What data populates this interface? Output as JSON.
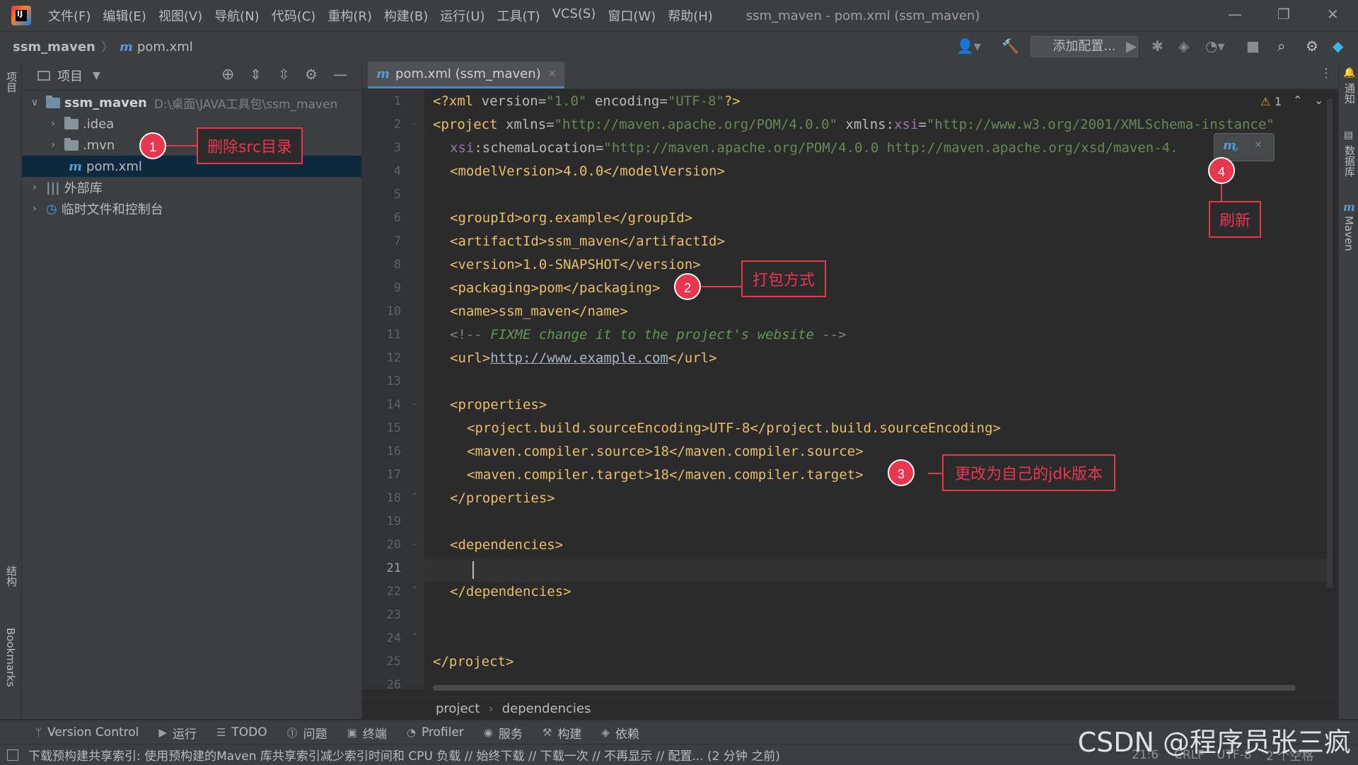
{
  "titlebar": {
    "menu": [
      "文件(F)",
      "编辑(E)",
      "视图(V)",
      "导航(N)",
      "代码(C)",
      "重构(R)",
      "构建(B)",
      "运行(U)",
      "工具(T)",
      "VCS(S)",
      "窗口(W)",
      "帮助(H)"
    ],
    "window_title": "ssm_maven - pom.xml (ssm_maven)"
  },
  "navbar": {
    "project": "ssm_maven",
    "file": "pom.xml",
    "config_button": "添加配置..."
  },
  "left_strip": {
    "project_label": "项目",
    "structure_label": "结构",
    "bookmarks_label": "Bookmarks"
  },
  "right_strip": {
    "notifications_label": "通知",
    "database_label": "数据库",
    "maven_label": "Maven"
  },
  "project_panel": {
    "title": "项目",
    "tree": {
      "root_name": "ssm_maven",
      "root_path": "D:\\桌面\\JAVA工具包\\ssm_maven",
      "idea": ".idea",
      "mvn": ".mvn",
      "pom": "pom.xml",
      "external_libs": "外部库",
      "scratches": "临时文件和控制台"
    }
  },
  "editor": {
    "tab_label": "pom.xml (ssm_maven)",
    "warning_count": "1",
    "line_numbers": [
      "1",
      "2",
      "3",
      "4",
      "5",
      "6",
      "7",
      "8",
      "9",
      "10",
      "11",
      "12",
      "13",
      "14",
      "15",
      "16",
      "17",
      "18",
      "19",
      "20",
      "21",
      "22",
      "23",
      "24",
      "25",
      "26"
    ],
    "code": {
      "l1a": "<?xml ",
      "l1b": "version",
      "l1c": "=",
      "l1d": "\"1.0\"",
      "l1e": " encoding",
      "l1f": "=",
      "l1g": "\"UTF-8\"",
      "l1h": "?>",
      "l2a": "<project ",
      "l2b": "xmlns",
      "l2c": "=",
      "l2d": "\"http://maven.apache.org/POM/4.0.0\"",
      "l2e": " xmlns:",
      "l2f": "xsi",
      "l2g": "=",
      "l2h": "\"http://www.w3.org/2001/XMLSchema-instance\"",
      "l3a": "xsi",
      "l3b": ":schemaLocation",
      "l3c": "=",
      "l3d": "\"http://maven.apache.org/POM/4.0.0 http://maven.apache.org/xsd/maven-4.",
      "l3e": "\">",
      "l4": "<modelVersion>4.0.0</modelVersion>",
      "l6": "<groupId>org.example</groupId>",
      "l7": "<artifactId>ssm_maven</artifactId>",
      "l8": "<version>1.0-SNAPSHOT</version>",
      "l9": "<packaging>pom</packaging>",
      "l10": "<name>ssm_maven</name>",
      "l11a": "<!-- ",
      "l11b": "FIXME change it to the project's website",
      "l11c": " -->",
      "l12a": "<url>",
      "l12b": "http://www.example.com",
      "l12c": "</url>",
      "l14": "<properties>",
      "l15": "<project.build.sourceEncoding>UTF-8</project.build.sourceEncoding>",
      "l16": "<maven.compiler.source>18</maven.compiler.source>",
      "l17": "<maven.compiler.target>18</maven.compiler.target>",
      "l18": "</properties>",
      "l20": "<dependencies>",
      "l22": "</dependencies>",
      "l25": "</project>"
    },
    "breadcrumbs": [
      "project",
      "dependencies"
    ]
  },
  "annotations": {
    "a1_num": "1",
    "a1_text": "删除src目录",
    "a2_num": "2",
    "a2_text": "打包方式",
    "a3_num": "3",
    "a3_text": "更改为自己的jdk版本",
    "a4_num": "4",
    "a4_text": "刷新"
  },
  "bottombar": {
    "items": [
      "Version Control",
      "运行",
      "TODO",
      "问题",
      "终端",
      "Profiler",
      "服务",
      "构建",
      "依赖"
    ]
  },
  "statusbar": {
    "message": "下载预构建共享索引: 使用预构建的Maven 库共享索引减少索引时间和 CPU 负载 // 始终下载 // 下载一次 // 不再显示 // 配置... (2 分钟 之前)",
    "position": "21:6",
    "line_sep": "CRLF",
    "encoding": "UTF-8",
    "indent": "2 个空格"
  },
  "watermark": "CSDN @程序员张三疯",
  "colors": {
    "accent": "#4a88c7",
    "annotation": "#e8364f"
  }
}
